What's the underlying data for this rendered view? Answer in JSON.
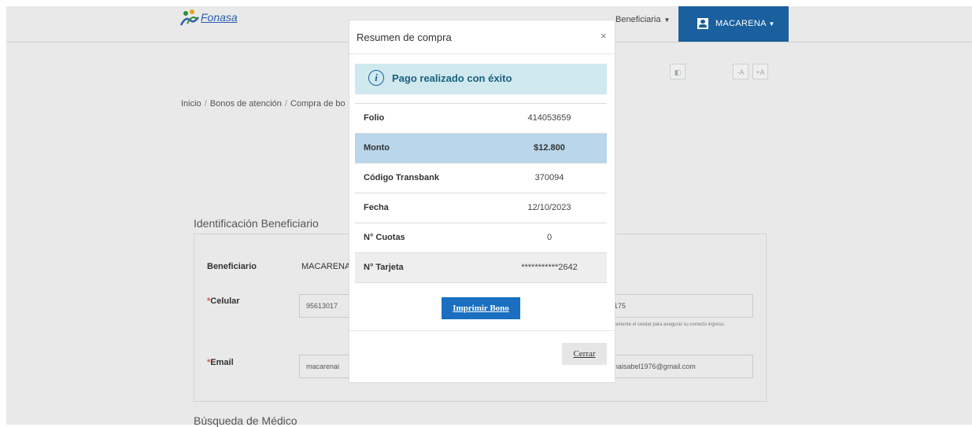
{
  "header": {
    "logo_text": "Fonasa",
    "beneficiaria_menu": "Beneficiaria",
    "user_name": "MACARENA"
  },
  "accessibility": {
    "contrast": "◧",
    "font_decrease": "-A",
    "font_increase": "+A"
  },
  "breadcrumb": [
    "Inicio",
    "Bonos de atención",
    "Compra de bo"
  ],
  "identificacion": {
    "title": "Identificación Beneficiario",
    "beneficiario_label": "Beneficiario",
    "beneficiario_value": "MACARENA",
    "celular_label": "Celular",
    "celular_value": "95613017",
    "celular_confirm_value": "175",
    "celular_hint": "amente el celular para asegurar su correcto ingreso.",
    "email_label": "Email",
    "email_value": "macarenai",
    "email_confirm_value": "naisabel1976@gmail.com"
  },
  "busqueda": {
    "title": "Búsqueda de Médico"
  },
  "modal": {
    "title": "Resumen de compra",
    "close_symbol": "×",
    "alert_icon": "i",
    "alert_text": "Pago realizado con éxito",
    "rows": [
      {
        "label": "Folio",
        "value": "414053659"
      },
      {
        "label": "Monto",
        "value": "$12.800"
      },
      {
        "label": "Código Transbank",
        "value": "370094"
      },
      {
        "label": "Fecha",
        "value": "12/10/2023"
      },
      {
        "label": "N° Cuotas",
        "value": "0"
      },
      {
        "label": "N° Tarjeta",
        "value": "***********2642"
      }
    ],
    "print_button": "Imprimir Bono",
    "close_button": "Cerrar"
  },
  "colors": {
    "primary": "#1a5f9e",
    "button": "#1a6fc0",
    "alert_bg": "#cfe9ee",
    "highlight_row": "#b9d6ea",
    "backdrop": "#e9e9e9"
  }
}
